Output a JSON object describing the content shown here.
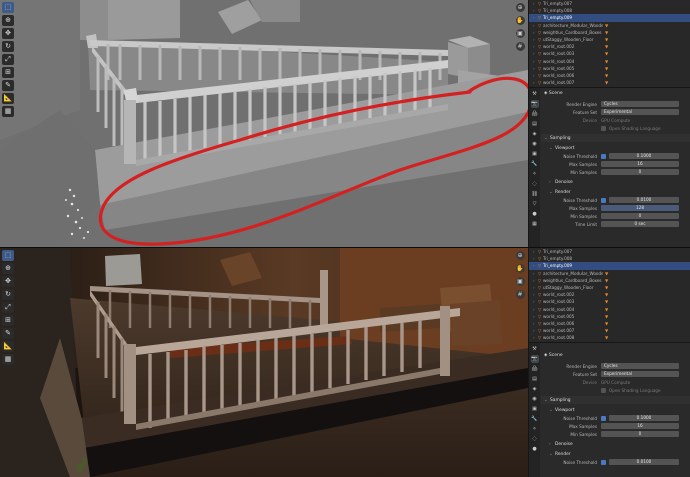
{
  "outliner": {
    "rows": [
      {
        "name": "Tri_empty.007",
        "selected": false
      },
      {
        "name": "Tri_empty.008",
        "selected": false
      },
      {
        "name": "Tri_empty.009",
        "selected": true
      },
      {
        "name": "architecture_Modular_Wooden",
        "selected": false
      },
      {
        "name": "weightlus_Cardboard_Boxes",
        "selected": false
      },
      {
        "name": "utStaggy_Wooden_Floor",
        "selected": false
      },
      {
        "name": "world_root.002",
        "selected": false
      },
      {
        "name": "world_root.003",
        "selected": false
      },
      {
        "name": "world_root.004",
        "selected": false
      },
      {
        "name": "world_root.005",
        "selected": false
      },
      {
        "name": "world_root.006",
        "selected": false
      },
      {
        "name": "world_root.007",
        "selected": false
      },
      {
        "name": "world_root.008",
        "selected": false
      }
    ]
  },
  "properties": {
    "scene_label": "Scene",
    "render_engine_label": "Render Engine",
    "render_engine_value": "Cycles",
    "feature_set_label": "Feature Set",
    "feature_set_value": "Experimental",
    "device_label": "Device",
    "device_value": "GPU Compute",
    "osl_label": "Open Shading Language",
    "sampling_label": "Sampling",
    "viewport_label": "Viewport",
    "noise_threshold_label": "Noise Threshold",
    "viewport_noise_threshold": "0.1000",
    "max_samples_label": "Max Samples",
    "viewport_max_samples": "16",
    "min_samples_label": "Min Samples",
    "viewport_min_samples": "0",
    "denoise_label": "Denoise",
    "render_label": "Render",
    "render_noise_threshold": "0.0100",
    "render_max_samples": "128",
    "render_min_samples": "0",
    "time_limit_label": "Time Limit",
    "render_time_limit": "0 sec"
  },
  "theme": {
    "annotation_stroke": "#d42020",
    "selection": "#334d80",
    "accent_checkbox": "#4a79c4"
  }
}
